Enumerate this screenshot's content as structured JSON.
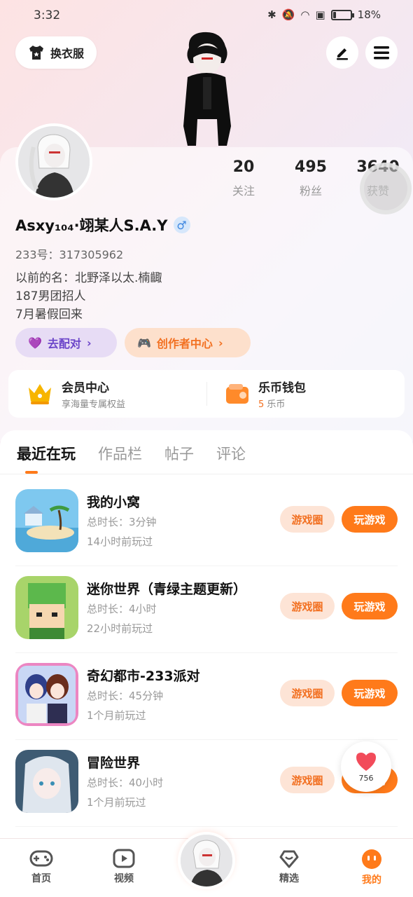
{
  "status_bar": {
    "time": "3:32",
    "battery": "18%",
    "battery_level": 0.18
  },
  "header": {
    "wardrobe_label": "换衣服"
  },
  "profile": {
    "stats": [
      {
        "value": "20",
        "label": "关注"
      },
      {
        "value": "495",
        "label": "粉丝"
      },
      {
        "value": "3640",
        "label": "获赞"
      }
    ],
    "username": "Asxy₁₀₄·翊某人S.A.Y",
    "gender_symbol": "♂",
    "uid": "233号：317305962",
    "bio": [
      "以前的名：北野泽以太.楠齱",
      "187男团招人",
      "7月暑假回来"
    ],
    "chip_pair": "去配对",
    "chip_creator": "创作者中心"
  },
  "benefits": {
    "member_title": "会员中心",
    "member_sub": "享海量专属权益",
    "wallet_title": "乐币钱包",
    "wallet_coins": "5",
    "wallet_unit": "乐币"
  },
  "tabs": [
    "最近在玩",
    "作品栏",
    "帖子",
    "评论"
  ],
  "games": [
    {
      "title": "我的小窝",
      "time": "总时长：3分钟",
      "last": "14小时前玩过",
      "circle_label": "游戏圈",
      "play_label": "玩游戏"
    },
    {
      "title": "迷你世界（青绿主题更新）",
      "time": "总时长：4小时",
      "last": "22小时前玩过",
      "circle_label": "游戏圈",
      "play_label": "玩游戏"
    },
    {
      "title": "奇幻都市-233派对",
      "time": "总时长：45分钟",
      "last": "1个月前玩过",
      "circle_label": "游戏圈",
      "play_label": "玩游戏"
    },
    {
      "title": "冒险世界",
      "time": "总时长：40小时",
      "last": "1个月前玩过",
      "circle_label": "游戏圈",
      "play_label": "玩游戏"
    }
  ],
  "fab": {
    "count": "756"
  },
  "nav": {
    "home": "首页",
    "video": "视频",
    "featured": "精选",
    "mine": "我的"
  },
  "colors": {
    "accent": "#ff7a1a",
    "purple": "#6b45c9"
  }
}
